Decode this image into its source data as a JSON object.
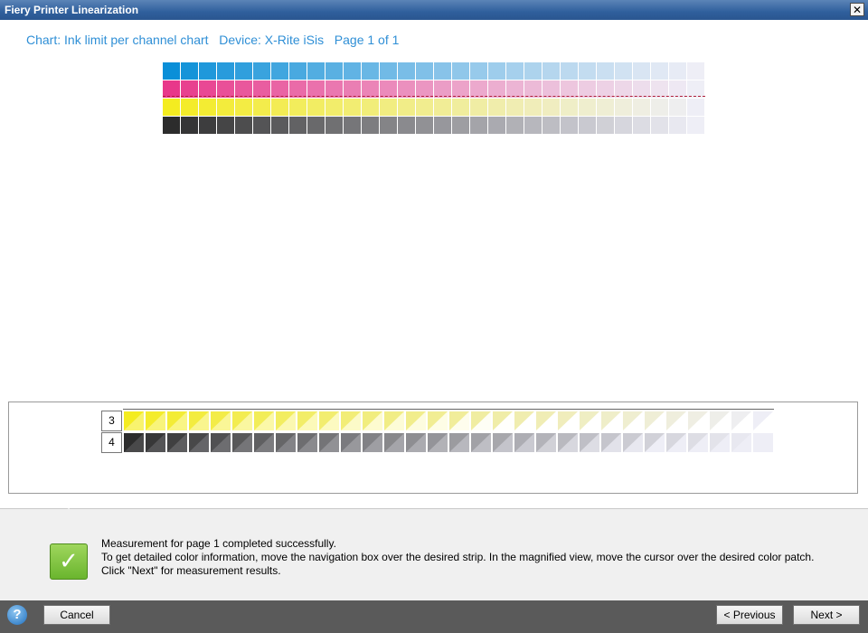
{
  "window": {
    "title": "Fiery Printer Linearization",
    "close_glyph": "✕"
  },
  "chart_info": {
    "chart": "Chart: Ink limit per channel chart",
    "device": "Device: X-Rite iSis",
    "page": "Page 1 of 1"
  },
  "grid": {
    "rows": [
      "cyan",
      "magenta",
      "yellow",
      "black"
    ],
    "columns": 30
  },
  "magnifier": {
    "rows": [
      {
        "label": "3",
        "channel": "yellow"
      },
      {
        "label": "4",
        "channel": "black"
      }
    ],
    "columns": 30
  },
  "colors": {
    "cyan": "#0a8fd8",
    "magenta": "#e8388a",
    "yellow": "#f4ec20",
    "black": "#2c2c2c",
    "paper": "#eeeef6",
    "accent_text": "#2f8fd6"
  },
  "status": {
    "icon": "check-icon",
    "lines": [
      "Measurement for page 1 completed successfully.",
      "To get detailed color information, move the navigation box over the desired strip. In the magnified view, move the cursor over the desired color patch.",
      "Click \"Next\" for measurement results."
    ]
  },
  "footer": {
    "help_glyph": "?",
    "cancel_label": "Cancel",
    "previous_label": "< Previous",
    "next_label": "Next >"
  }
}
